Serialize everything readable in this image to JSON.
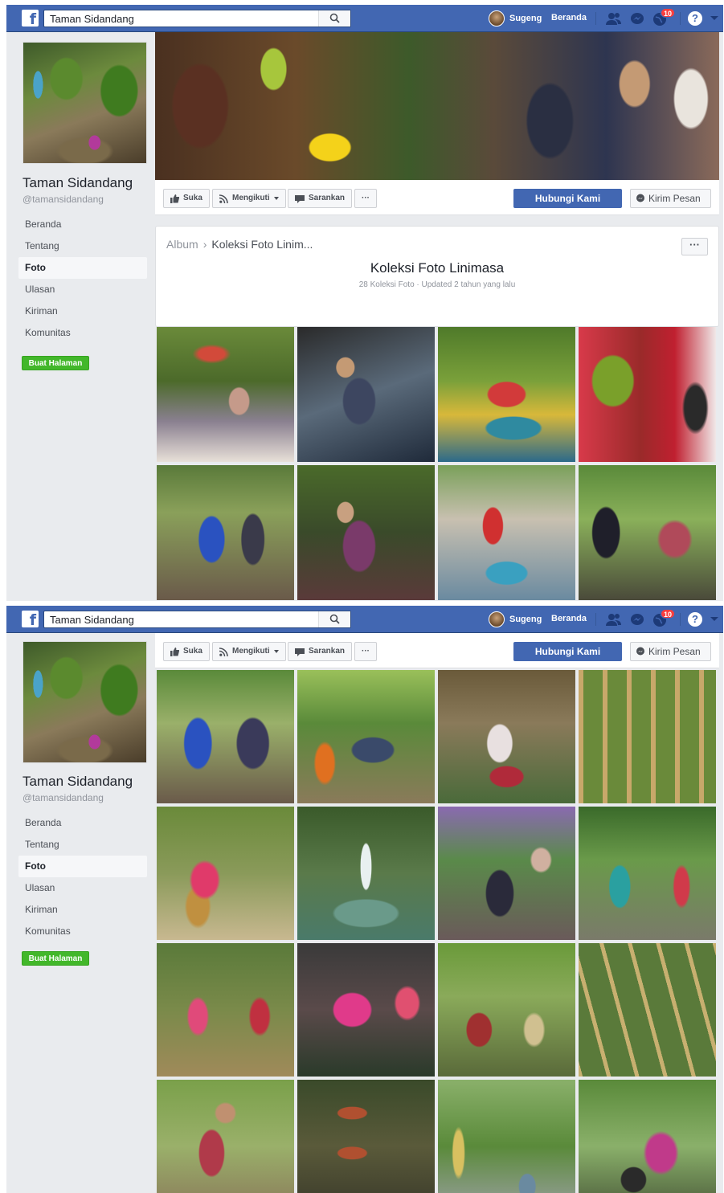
{
  "topbar": {
    "logo": "f",
    "search_value": "Taman Sidandang",
    "search_icon": "search-icon",
    "user_name": "Sugeng",
    "home_label": "Beranda",
    "notification_count": "10",
    "help_label": "?"
  },
  "page": {
    "name": "Taman Sidandang",
    "handle": "@tamansidandang"
  },
  "sidebar": {
    "items": [
      {
        "label": "Beranda"
      },
      {
        "label": "Tentang"
      },
      {
        "label": "Foto",
        "active": true
      },
      {
        "label": "Ulasan"
      },
      {
        "label": "Kiriman"
      },
      {
        "label": "Komunitas"
      }
    ],
    "create_page_label": "Buat Halaman"
  },
  "actions": {
    "like_label": "Suka",
    "follow_label": "Mengikuti",
    "share_label": "Sarankan",
    "more_label": "···",
    "contact_label": "Hubungi Kami",
    "message_label": "Kirim Pesan"
  },
  "album": {
    "breadcrumb_root": "Album",
    "breadcrumb_current": "Koleksi Foto Linim...",
    "title": "Koleksi Foto Linimasa",
    "meta": "28 Koleksi Foto · Updated 2 tahun yang lalu",
    "more_label": "···"
  },
  "colors": {
    "brand": "#4267b2",
    "create_button": "#42b72a",
    "background": "#e9ebee"
  }
}
